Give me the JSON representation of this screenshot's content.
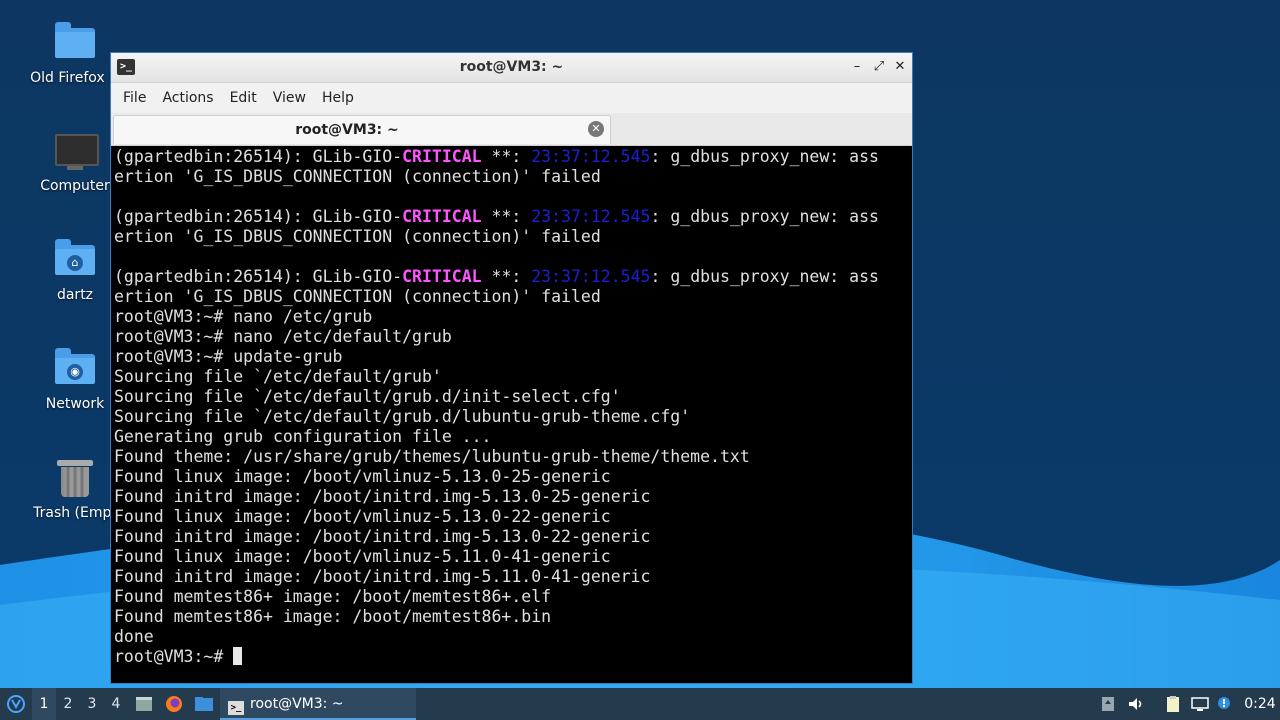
{
  "desktop": {
    "icons": [
      {
        "label": "Old Firefox D",
        "icon": "folder-icon"
      },
      {
        "label": "Computer",
        "icon": "computer-icon"
      },
      {
        "label": "dartz",
        "icon": "home-folder-icon"
      },
      {
        "label": "Network",
        "icon": "network-folder-icon"
      },
      {
        "label": "Trash (Empt",
        "icon": "trash-icon"
      }
    ]
  },
  "window": {
    "title": "root@VM3: ~",
    "controls": {
      "minimize": "–",
      "maximize": "⤢",
      "close": "✕"
    },
    "menu": [
      "File",
      "Actions",
      "Edit",
      "View",
      "Help"
    ],
    "tab": {
      "label": "root@VM3: ~",
      "close": "✕"
    }
  },
  "terminal": {
    "lines": [
      {
        "segments": [
          {
            "t": "(gpartedbin:26514): GLib-GIO-"
          },
          {
            "t": "CRITICAL",
            "c": "crit"
          },
          {
            "t": " **: "
          },
          {
            "t": "23:37:12.545",
            "c": "ts"
          },
          {
            "t": ": g_dbus_proxy_new: ass"
          }
        ]
      },
      {
        "segments": [
          {
            "t": "ertion 'G_IS_DBUS_CONNECTION (connection)' failed"
          }
        ]
      },
      {
        "segments": [
          {
            "t": ""
          }
        ]
      },
      {
        "segments": [
          {
            "t": "(gpartedbin:26514): GLib-GIO-"
          },
          {
            "t": "CRITICAL",
            "c": "crit"
          },
          {
            "t": " **: "
          },
          {
            "t": "23:37:12.545",
            "c": "ts"
          },
          {
            "t": ": g_dbus_proxy_new: ass"
          }
        ]
      },
      {
        "segments": [
          {
            "t": "ertion 'G_IS_DBUS_CONNECTION (connection)' failed"
          }
        ]
      },
      {
        "segments": [
          {
            "t": ""
          }
        ]
      },
      {
        "segments": [
          {
            "t": "(gpartedbin:26514): GLib-GIO-"
          },
          {
            "t": "CRITICAL",
            "c": "crit"
          },
          {
            "t": " **: "
          },
          {
            "t": "23:37:12.545",
            "c": "ts"
          },
          {
            "t": ": g_dbus_proxy_new: ass"
          }
        ]
      },
      {
        "segments": [
          {
            "t": "ertion 'G_IS_DBUS_CONNECTION (connection)' failed"
          }
        ]
      },
      {
        "segments": [
          {
            "t": "root@VM3:~# nano /etc/grub"
          }
        ]
      },
      {
        "segments": [
          {
            "t": "root@VM3:~# nano /etc/default/grub"
          }
        ]
      },
      {
        "segments": [
          {
            "t": "root@VM3:~# update-grub"
          }
        ]
      },
      {
        "segments": [
          {
            "t": "Sourcing file `/etc/default/grub'"
          }
        ]
      },
      {
        "segments": [
          {
            "t": "Sourcing file `/etc/default/grub.d/init-select.cfg'"
          }
        ]
      },
      {
        "segments": [
          {
            "t": "Sourcing file `/etc/default/grub.d/lubuntu-grub-theme.cfg'"
          }
        ]
      },
      {
        "segments": [
          {
            "t": "Generating grub configuration file ..."
          }
        ]
      },
      {
        "segments": [
          {
            "t": "Found theme: /usr/share/grub/themes/lubuntu-grub-theme/theme.txt"
          }
        ]
      },
      {
        "segments": [
          {
            "t": "Found linux image: /boot/vmlinuz-5.13.0-25-generic"
          }
        ]
      },
      {
        "segments": [
          {
            "t": "Found initrd image: /boot/initrd.img-5.13.0-25-generic"
          }
        ]
      },
      {
        "segments": [
          {
            "t": "Found linux image: /boot/vmlinuz-5.13.0-22-generic"
          }
        ]
      },
      {
        "segments": [
          {
            "t": "Found initrd image: /boot/initrd.img-5.13.0-22-generic"
          }
        ]
      },
      {
        "segments": [
          {
            "t": "Found linux image: /boot/vmlinuz-5.11.0-41-generic"
          }
        ]
      },
      {
        "segments": [
          {
            "t": "Found initrd image: /boot/initrd.img-5.11.0-41-generic"
          }
        ]
      },
      {
        "segments": [
          {
            "t": "Found memtest86+ image: /boot/memtest86+.elf"
          }
        ]
      },
      {
        "segments": [
          {
            "t": "Found memtest86+ image: /boot/memtest86+.bin"
          }
        ]
      },
      {
        "segments": [
          {
            "t": "done"
          }
        ]
      }
    ],
    "prompt": "root@VM3:~# "
  },
  "taskbar": {
    "workspaces": [
      "1",
      "2",
      "3",
      "4"
    ],
    "active_workspace": "1",
    "task_label": "root@VM3: ~",
    "clock": "0:24"
  },
  "colors": {
    "critical": "#ff55ff",
    "timestamp": "#1e1ed6",
    "taskbar": "#243b4e"
  }
}
